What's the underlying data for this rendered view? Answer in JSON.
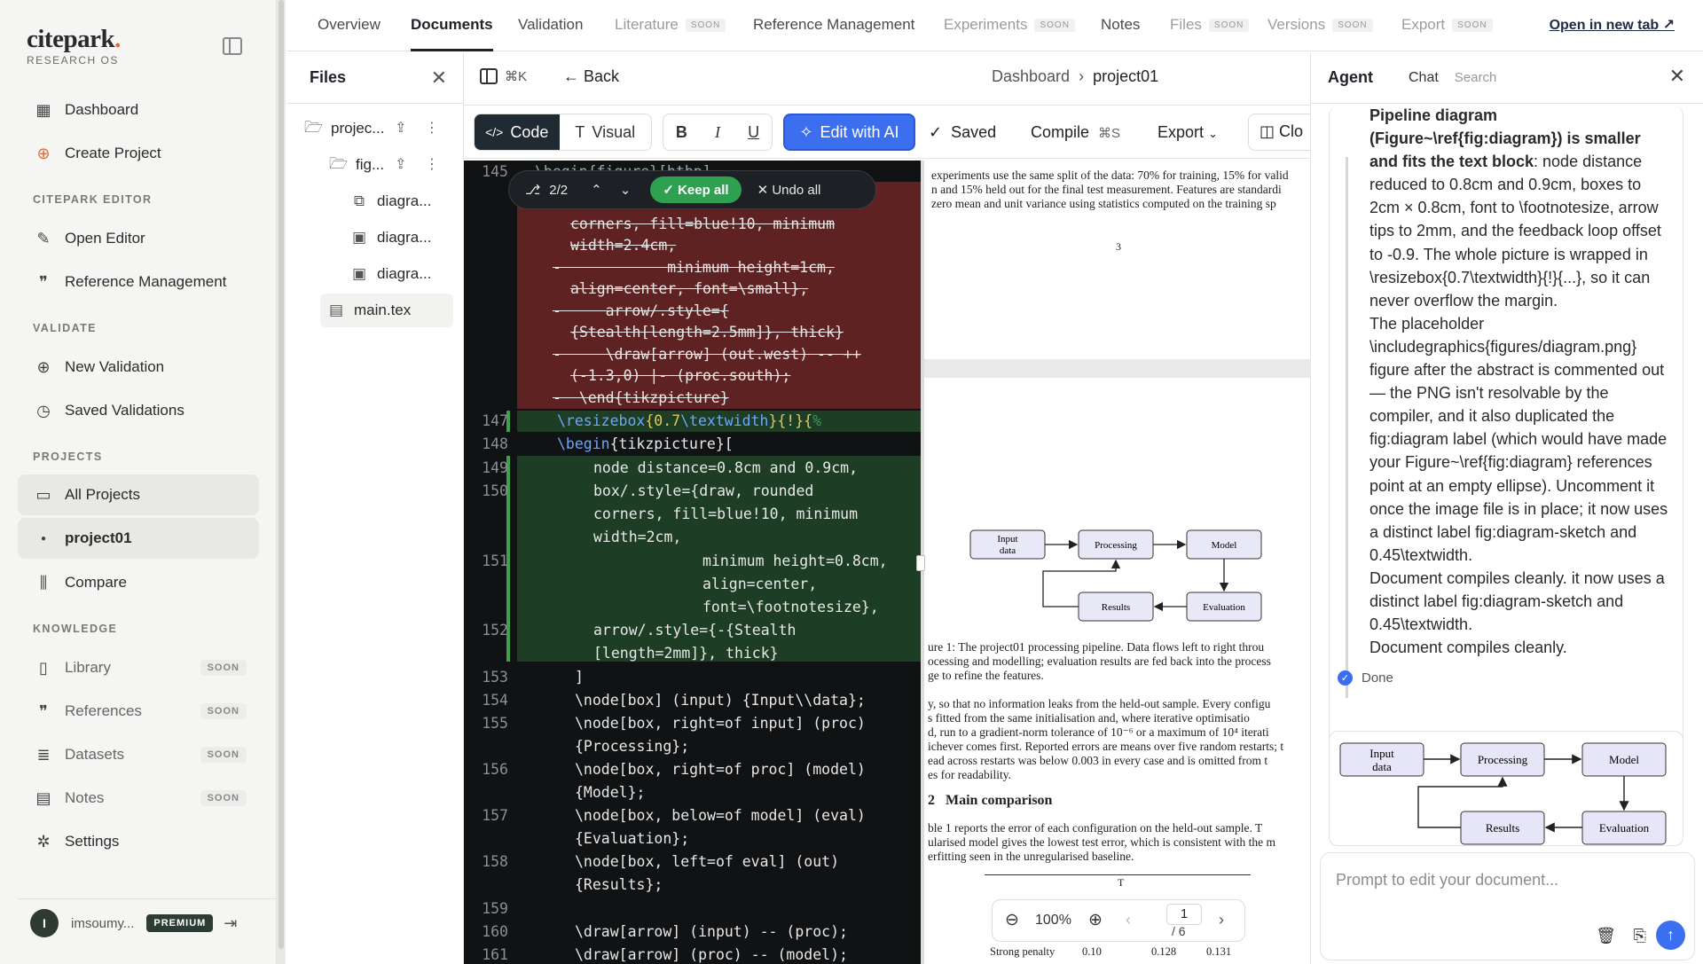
{
  "brand": {
    "name": "citepark",
    "dot": ".",
    "sub": "RESEARCH OS"
  },
  "sidebar": {
    "dashboard": "Dashboard",
    "create": "Create Project",
    "sec_editor": "CITEPARK EDITOR",
    "open_editor": "Open Editor",
    "refmgmt": "Reference Management",
    "sec_validate": "VALIDATE",
    "new_validation": "New Validation",
    "saved_validations": "Saved Validations",
    "sec_projects": "PROJECTS",
    "all_projects": "All Projects",
    "project01": "project01",
    "compare": "Compare",
    "sec_knowledge": "KNOWLEDGE",
    "library": "Library",
    "references": "References",
    "datasets": "Datasets",
    "notes": "Notes",
    "soon": "SOON",
    "settings": "Settings",
    "user_initial": "I",
    "user_name": "imsoumy...",
    "premium": "PREMIUM"
  },
  "tabs": [
    "Overview",
    "Documents",
    "Validation",
    "Literature",
    "Reference Management",
    "Experiments",
    "Notes",
    "Files",
    "Versions",
    "Export"
  ],
  "tab_soon": "SOON",
  "open_new_tab": "Open in new tab ↗",
  "files": {
    "title": "Files",
    "items": [
      "projec...",
      "fig...",
      "diagra...",
      "diagra...",
      "diagra...",
      "main.tex"
    ]
  },
  "editor": {
    "kbd": "⌘K",
    "back": "Back",
    "crumb1": "Dashboard",
    "crumb2": "project01",
    "code": "Code",
    "visual": "Visual",
    "bold": "B",
    "italic": "I",
    "underline": "U",
    "edit_ai": "Edit with AI",
    "saved": "Saved",
    "compile": "Compile",
    "compile_kbd": "⌘S",
    "export": "Export",
    "close": "Clo",
    "diff_count": "2/2",
    "keep_all": "Keep all",
    "undo_all": "Undo all",
    "line_numbers": [
      "145",
      "147",
      "148",
      "149",
      "150",
      "151",
      "152",
      "153",
      "154",
      "155",
      "156",
      "157",
      "158",
      "159",
      "160",
      "161"
    ],
    "deleted": [
      "corners, fill=blue!10, minimum",
      "width=2.4cm,",
      "-            minimum height=1cm,",
      "align=center, font=\\small},",
      "-     arrow/.style={",
      "{Stealth[length=2.5mm]}, thick}",
      "-     \\draw[arrow] (out.west) -- ++",
      "(-1.3,0) |- (proc.south);",
      "-  \\end{tikzpicture}"
    ],
    "line145": "\\begin{figure}[htbp]",
    "lines": {
      "l147a": "\\resizebox",
      "l147b": "{0.7",
      "l147c": "\\textwidth",
      "l147d": "}{!}{",
      "l148a": "\\begin",
      "l148b": "{tikzpicture}[",
      "l149": "node distance=0.8cm and 0.9cm,",
      "l150a": "box/.style={draw, rounded",
      "l150b": "corners, fill=blue!10, minimum",
      "l150c": "width=2cm,",
      "l151a": "minimum height=0.8cm,",
      "l151b": "align=center,",
      "l151c": "font=\\footnotesize},",
      "l152a": "arrow/.style={-{Stealth",
      "l152b": "[length=2mm]}, thick}",
      "l153": "]",
      "l154": "\\node[box] (input) {Input\\\\data};",
      "l155a": "\\node[box, right=of input] (proc)",
      "l155b": "{Processing};",
      "l156a": "\\node[box, right=of proc] (model)",
      "l156b": "{Model};",
      "l157a": "\\node[box, below=of model] (eval)",
      "l157b": "{Evaluation};",
      "l158a": "\\node[box, left=of eval] (out)",
      "l158b": "{Results};",
      "l160": "\\draw[arrow] (input) -- (proc);",
      "l161": "\\draw[arrow] (proc) -- (model);"
    }
  },
  "pdf": {
    "p1": [
      "experiments use the same split of the data: 70% for training, 15% for valid",
      "n and 15% held out for the final test measurement. Features are standardi",
      "zero mean and unit variance using statistics computed on the training sp"
    ],
    "page_num": "3",
    "diagram": {
      "input": "Input\ndata",
      "processing": "Processing",
      "model": "Model",
      "results": "Results",
      "evaluation": "Evaluation"
    },
    "caption": [
      "ure 1: The project01 processing pipeline. Data flows left to right throu",
      "ocessing and modelling; evaluation results are fed back into the process",
      "ge to refine the features."
    ],
    "para2": [
      "y, so that no information leaks from the held-out sample. Every configu",
      "s fitted from the same initialisation and, where iterative optimisatio",
      "d, run to a gradient-norm tolerance of 10⁻⁶ or a maximum of 10⁴ iterati",
      "ichever comes first. Reported errors are means over five random restarts; t",
      "ead across restarts was below 0.003 in every case and is omitted from t",
      "es for readability."
    ],
    "section": "2   Main comparison",
    "para3": [
      "ble 1 reports the error of each configuration on the held-out sample. T",
      "ularised model gives the lowest test error, which is consistent with the m",
      "erfitting seen in the unregularised baseline."
    ],
    "table_row": [
      "Strong penalty",
      "0.10",
      "0.128",
      "0.131"
    ],
    "table_head": "T",
    "zoom": "100%",
    "page": "1",
    "pages": "/ 6"
  },
  "agent": {
    "title": "Agent",
    "chat": "Chat",
    "search": "Search",
    "msg_bold": "Pipeline diagram (Figure~\\ref{fig:diagram}) is smaller and fits the text block",
    "msg1": ": node distance reduced to 0.8cm and 0.9cm, boxes to 2cm × 0.8cm, font to \\footnotesize, arrow tips to 2mm, and the feedback loop offset to -0.9. The whole picture is wrapped in \\resizebox{0.7\\textwidth}{!}{...}, so it can never overflow the margin.",
    "msg2": "The placeholder \\includegraphics{figures/diagram.png} figure after the abstract is commented out — the PNG isn't resolvable by the compiler, and it also duplicated the fig:diagram label (which would have made your Figure~\\ref{fig:diagram} references point at an empty ellipse). Uncomment it once the image file is in place; it now uses a distinct label fig:diagram-sketch and 0.45\\textwidth.",
    "msg3": "Document compiles cleanly. it now uses a distinct label fig:diagram-sketch and 0.45\\textwidth.",
    "msg4": "Document compiles cleanly.",
    "done": "Done",
    "prompt_placeholder": "Prompt to edit your document..."
  }
}
